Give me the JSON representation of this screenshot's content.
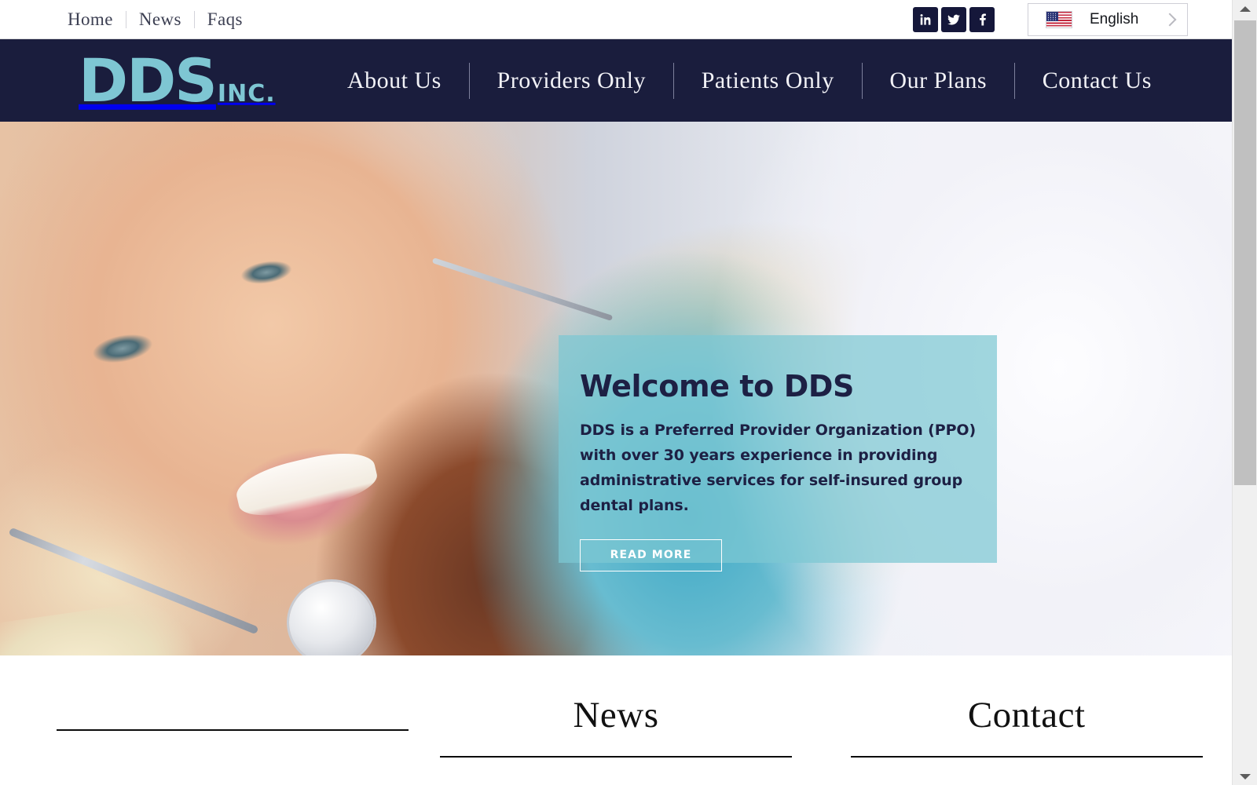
{
  "topbar": {
    "links": [
      {
        "label": "Home"
      },
      {
        "label": "News"
      },
      {
        "label": "Faqs"
      }
    ],
    "social": [
      {
        "name": "linkedin",
        "label": "LinkedIn"
      },
      {
        "name": "twitter",
        "label": "Twitter"
      },
      {
        "name": "facebook",
        "label": "Facebook"
      }
    ],
    "language": {
      "label": "English",
      "flag": "us-flag-icon",
      "chevron": "chevron-right-icon"
    }
  },
  "brand": {
    "main": "DDS",
    "suffix": "INC.",
    "color": "#7ec6d3",
    "bar_color": "#1a1d3d"
  },
  "mainnav": {
    "items": [
      {
        "label": "About Us"
      },
      {
        "label": "Providers Only"
      },
      {
        "label": "Patients Only"
      },
      {
        "label": "Our Plans"
      },
      {
        "label": "Contact Us"
      }
    ]
  },
  "hero": {
    "title": "Welcome to DDS",
    "body": "DDS is a Preferred Provider Organization (PPO) with over 30 years experience in providing administrative services for self-insured group dental plans.",
    "button_label": "READ MORE",
    "panel_color": "#7dc7d3",
    "text_color": "#1d2044"
  },
  "bottom": {
    "columns": [
      {
        "heading": ""
      },
      {
        "heading": "News"
      },
      {
        "heading": "Contact"
      }
    ]
  },
  "scrollbar": {
    "up_arrow": "scroll-up-arrow-icon",
    "down_arrow": "scroll-down-arrow-icon"
  }
}
